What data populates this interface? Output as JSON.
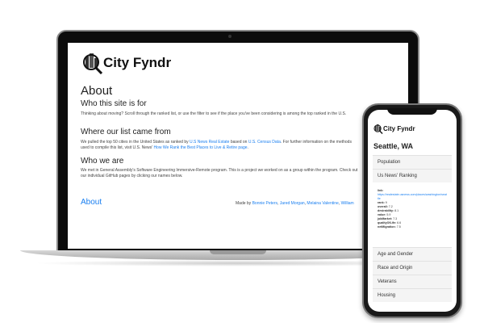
{
  "site": {
    "logo_text": "City Fyndr"
  },
  "laptop": {
    "title": "About",
    "sections": [
      {
        "heading": "Who this site is for",
        "text": "Thinking about moving? Scroll through the ranked list, or use the filter to see if the place you've been considering is among the top ranked in the U.S."
      },
      {
        "heading": "Where our list came from",
        "text_1": "We pulled the top 50 cities in the United States as ranked by ",
        "link_1": "U.S News Real Estate",
        "text_2": " based on ",
        "link_2": "U.S. Census Data",
        "text_3": ". For further information on the methods used to compile this list, visit U.S. News' ",
        "link_3": "How We Rank the Best Places to Live & Retire page",
        "text_4": "."
      },
      {
        "heading": "Who we are",
        "text": "We met in General Assembly's Software Engineering Immersive-Remote program. This is a project we worked on as a group within the program. Check out our individual GitHub pages by clicking our names below."
      }
    ],
    "footer": {
      "about_link": "About",
      "made_by": "Made by ",
      "names": [
        "Bonnie Peters",
        "Jared Morgan",
        "Melaina Valentine",
        "William"
      ]
    }
  },
  "phone": {
    "city": "Seattle, WA",
    "accordion": [
      "Population",
      "Us News' Ranking",
      "Age and Gender",
      "Race and Origin",
      "Veterans",
      "Housing"
    ],
    "ranking": {
      "link_label": "link:",
      "link": "https://realestate.usnews.com/places/washington/seattle",
      "rows": [
        {
          "k": "rank:",
          "v": "9"
        },
        {
          "k": "overall:",
          "v": "7.2"
        },
        {
          "k": "desirability:",
          "v": "8.1"
        },
        {
          "k": "value:",
          "v": "5.9"
        },
        {
          "k": "jobMarket:",
          "v": "7.3"
        },
        {
          "k": "qualityOfLife:",
          "v": "6.6"
        },
        {
          "k": "netMigration:",
          "v": "7.5"
        }
      ]
    }
  }
}
